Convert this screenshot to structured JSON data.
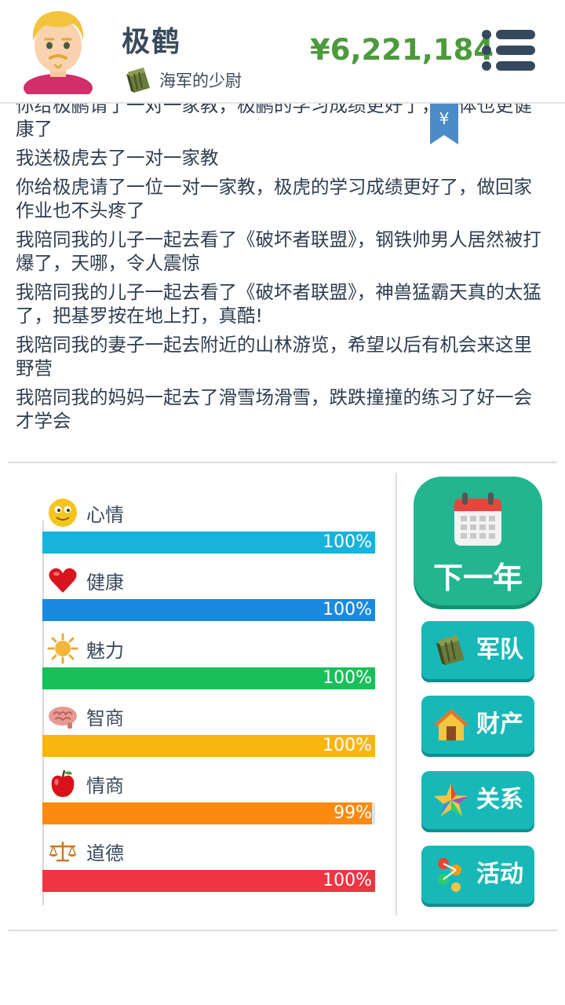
{
  "player": {
    "name": "极鹤",
    "rank": "海军的少尉",
    "money": "¥6,221,184"
  },
  "bookmark": {
    "symbol": "¥"
  },
  "log": [
    "你给极鹂请了一对一家教，极鹂的学习成绩更好了，身体也更健康了",
    "我送极虎去了一对一家教",
    "你给极虎请了一位一对一家教，极虎的学习成绩更好了，做回家作业也不头疼了",
    "我陪同我的儿子一起去看了《破坏者联盟》，钢铁帅男人居然被打爆了，天哪，令人震惊",
    "我陪同我的儿子一起去看了《破坏者联盟》，神兽猛霸天真的太猛了，把基罗按在地上打，真酷!",
    "我陪同我的妻子一起去附近的山林游览，希望以后有机会来这里野营",
    "我陪同我的妈妈一起去了滑雪场滑雪，跌跌撞撞的练习了好一会才学会"
  ],
  "stats": [
    {
      "label": "心情",
      "value": "100%",
      "fraction": 1.0,
      "color": "#17b3db",
      "icon": "smiley-icon"
    },
    {
      "label": "健康",
      "value": "100%",
      "fraction": 1.0,
      "color": "#1a8ae0",
      "icon": "heart-icon"
    },
    {
      "label": "魅力",
      "value": "100%",
      "fraction": 1.0,
      "color": "#19c05a",
      "icon": "sun-icon"
    },
    {
      "label": "智商",
      "value": "100%",
      "fraction": 1.0,
      "color": "#fbb50f",
      "icon": "brain-icon"
    },
    {
      "label": "情商",
      "value": "99%",
      "fraction": 0.99,
      "color": "#fb8a0e",
      "icon": "apple-icon"
    },
    {
      "label": "道德",
      "value": "100%",
      "fraction": 1.0,
      "color": "#ef3442",
      "icon": "scales-icon"
    }
  ],
  "actions": {
    "next_year": "下一年",
    "army": "军队",
    "assets": "财产",
    "relations": "关系",
    "activities": "活动"
  },
  "colors": {
    "money": "#4c9a3c",
    "next_year_button": "#22b590",
    "side_button": "#18b8b8"
  }
}
